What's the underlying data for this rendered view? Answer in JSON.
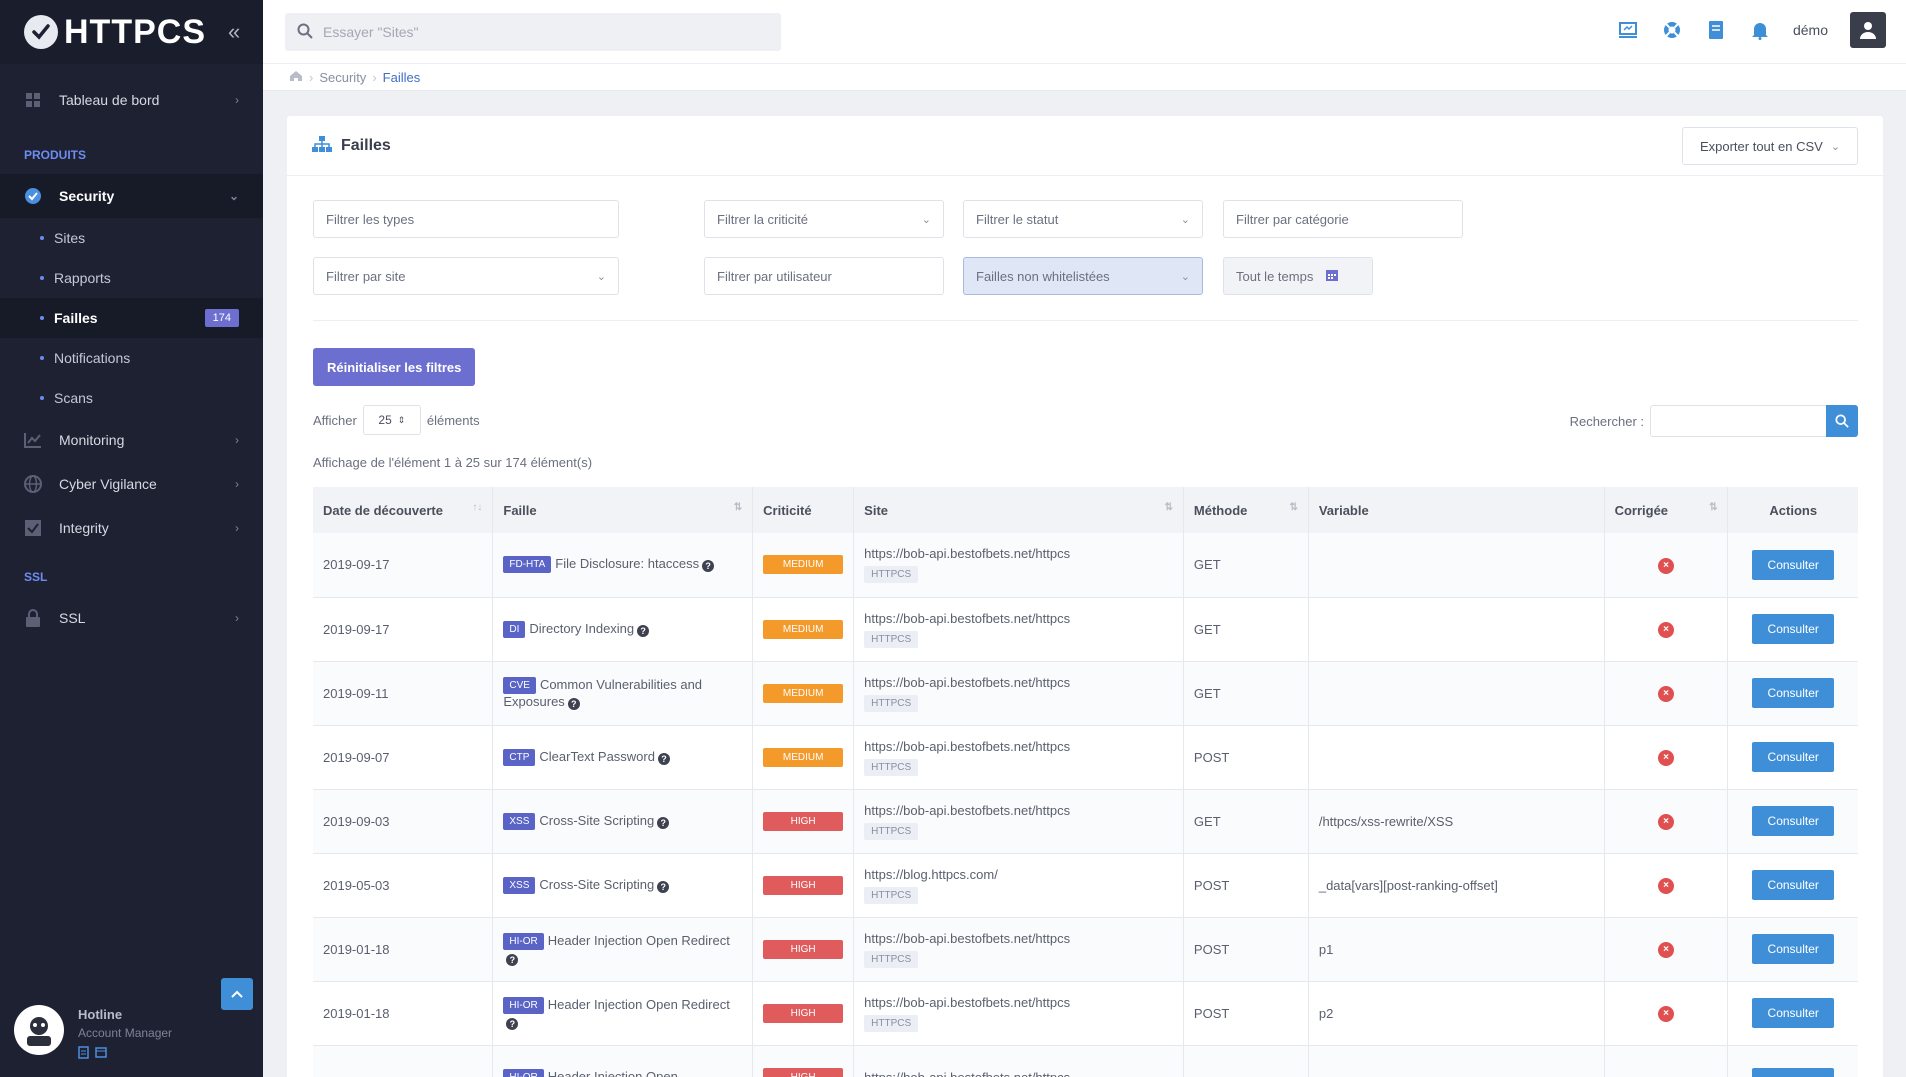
{
  "app": {
    "name": "HTTPCS"
  },
  "sidebar": {
    "dashboard": "Tableau de bord",
    "section_products": "PRODUITS",
    "security": "Security",
    "sub_items": [
      {
        "label": "Sites"
      },
      {
        "label": "Rapports"
      },
      {
        "label": "Failles",
        "badge": "174"
      },
      {
        "label": "Notifications"
      },
      {
        "label": "Scans"
      }
    ],
    "monitoring": "Monitoring",
    "cyber": "Cyber Vigilance",
    "integrity": "Integrity",
    "section_ssl": "SSL",
    "ssl": "SSL",
    "hotline_title": "Hotline",
    "hotline_sub": "Account Manager"
  },
  "topbar": {
    "search_placeholder": "Essayer \"Sites\"",
    "user": "démo"
  },
  "breadcrumb": {
    "level1": "Security",
    "level2": "Failles"
  },
  "card": {
    "title": "Failles",
    "export": "Exporter tout en CSV"
  },
  "filters": {
    "types": "Filtrer les types",
    "criticite": "Filtrer la criticité",
    "statut": "Filtrer le statut",
    "categorie": "Filtrer par catégorie",
    "site": "Filtrer par site",
    "utilisateur": "Filtrer par utilisateur",
    "whitelist": "Failles non whitelistées",
    "temps": "Tout le temps",
    "reset": "Réinitialiser les filtres"
  },
  "listing": {
    "show_label": "Afficher",
    "show_value": "25",
    "elements_label": "éléments",
    "search_label": "Rechercher :",
    "info": "Affichage de l'élément 1 à 25 sur 174 élément(s)"
  },
  "table": {
    "headers": [
      "Date de découverte",
      "Faille",
      "Criticité",
      "Site",
      "Méthode",
      "Variable",
      "Corrigée",
      "Actions"
    ],
    "action_label": "Consulter",
    "rows": [
      {
        "date": "2019-09-17",
        "code": "FD-HTA",
        "name": "File Disclosure: htaccess",
        "crit": "MEDIUM",
        "crit_color": "#f39a2b",
        "url": "https://bob-api.bestofbets.net/httpcs",
        "tag": "HTTPCS",
        "method": "GET",
        "variable": ""
      },
      {
        "date": "2019-09-17",
        "code": "DI",
        "name": "Directory Indexing",
        "crit": "MEDIUM",
        "crit_color": "#f39a2b",
        "url": "https://bob-api.bestofbets.net/httpcs",
        "tag": "HTTPCS",
        "method": "GET",
        "variable": ""
      },
      {
        "date": "2019-09-11",
        "code": "CVE",
        "name": "Common Vulnerabilities and Exposures",
        "crit": "MEDIUM",
        "crit_color": "#f39a2b",
        "url": "https://bob-api.bestofbets.net/httpcs",
        "tag": "HTTPCS",
        "method": "GET",
        "variable": ""
      },
      {
        "date": "2019-09-07",
        "code": "CTP",
        "name": "ClearText Password",
        "crit": "MEDIUM",
        "crit_color": "#f39a2b",
        "url": "https://bob-api.bestofbets.net/httpcs",
        "tag": "HTTPCS",
        "method": "POST",
        "variable": ""
      },
      {
        "date": "2019-09-03",
        "code": "XSS",
        "name": "Cross-Site Scripting",
        "crit": "HIGH",
        "crit_color": "#e05c5c",
        "url": "https://bob-api.bestofbets.net/httpcs",
        "tag": "HTTPCS",
        "method": "GET",
        "variable": "/httpcs/xss-rewrite/XSS"
      },
      {
        "date": "2019-05-03",
        "code": "XSS",
        "name": "Cross-Site Scripting",
        "crit": "HIGH",
        "crit_color": "#e05c5c",
        "url": "https://blog.httpcs.com/",
        "tag": "HTTPCS",
        "method": "POST",
        "variable": "_data[vars][post-ranking-offset]"
      },
      {
        "date": "2019-01-18",
        "code": "HI-OR",
        "name": "Header Injection Open Redirect",
        "crit": "HIGH",
        "crit_color": "#e05c5c",
        "url": "https://bob-api.bestofbets.net/httpcs",
        "tag": "HTTPCS",
        "method": "POST",
        "variable": "p1"
      },
      {
        "date": "2019-01-18",
        "code": "HI-OR",
        "name": "Header Injection Open Redirect",
        "crit": "HIGH",
        "crit_color": "#e05c5c",
        "url": "https://bob-api.bestofbets.net/httpcs",
        "tag": "HTTPCS",
        "method": "POST",
        "variable": "p2"
      },
      {
        "date": "",
        "code": "HI-OR",
        "name": "Header Injection Open",
        "crit": "HIGH",
        "crit_color": "#e05c5c",
        "url": "https://bob-api.bestofbets.net/httpcs",
        "tag": "",
        "method": "",
        "variable": ""
      }
    ]
  }
}
